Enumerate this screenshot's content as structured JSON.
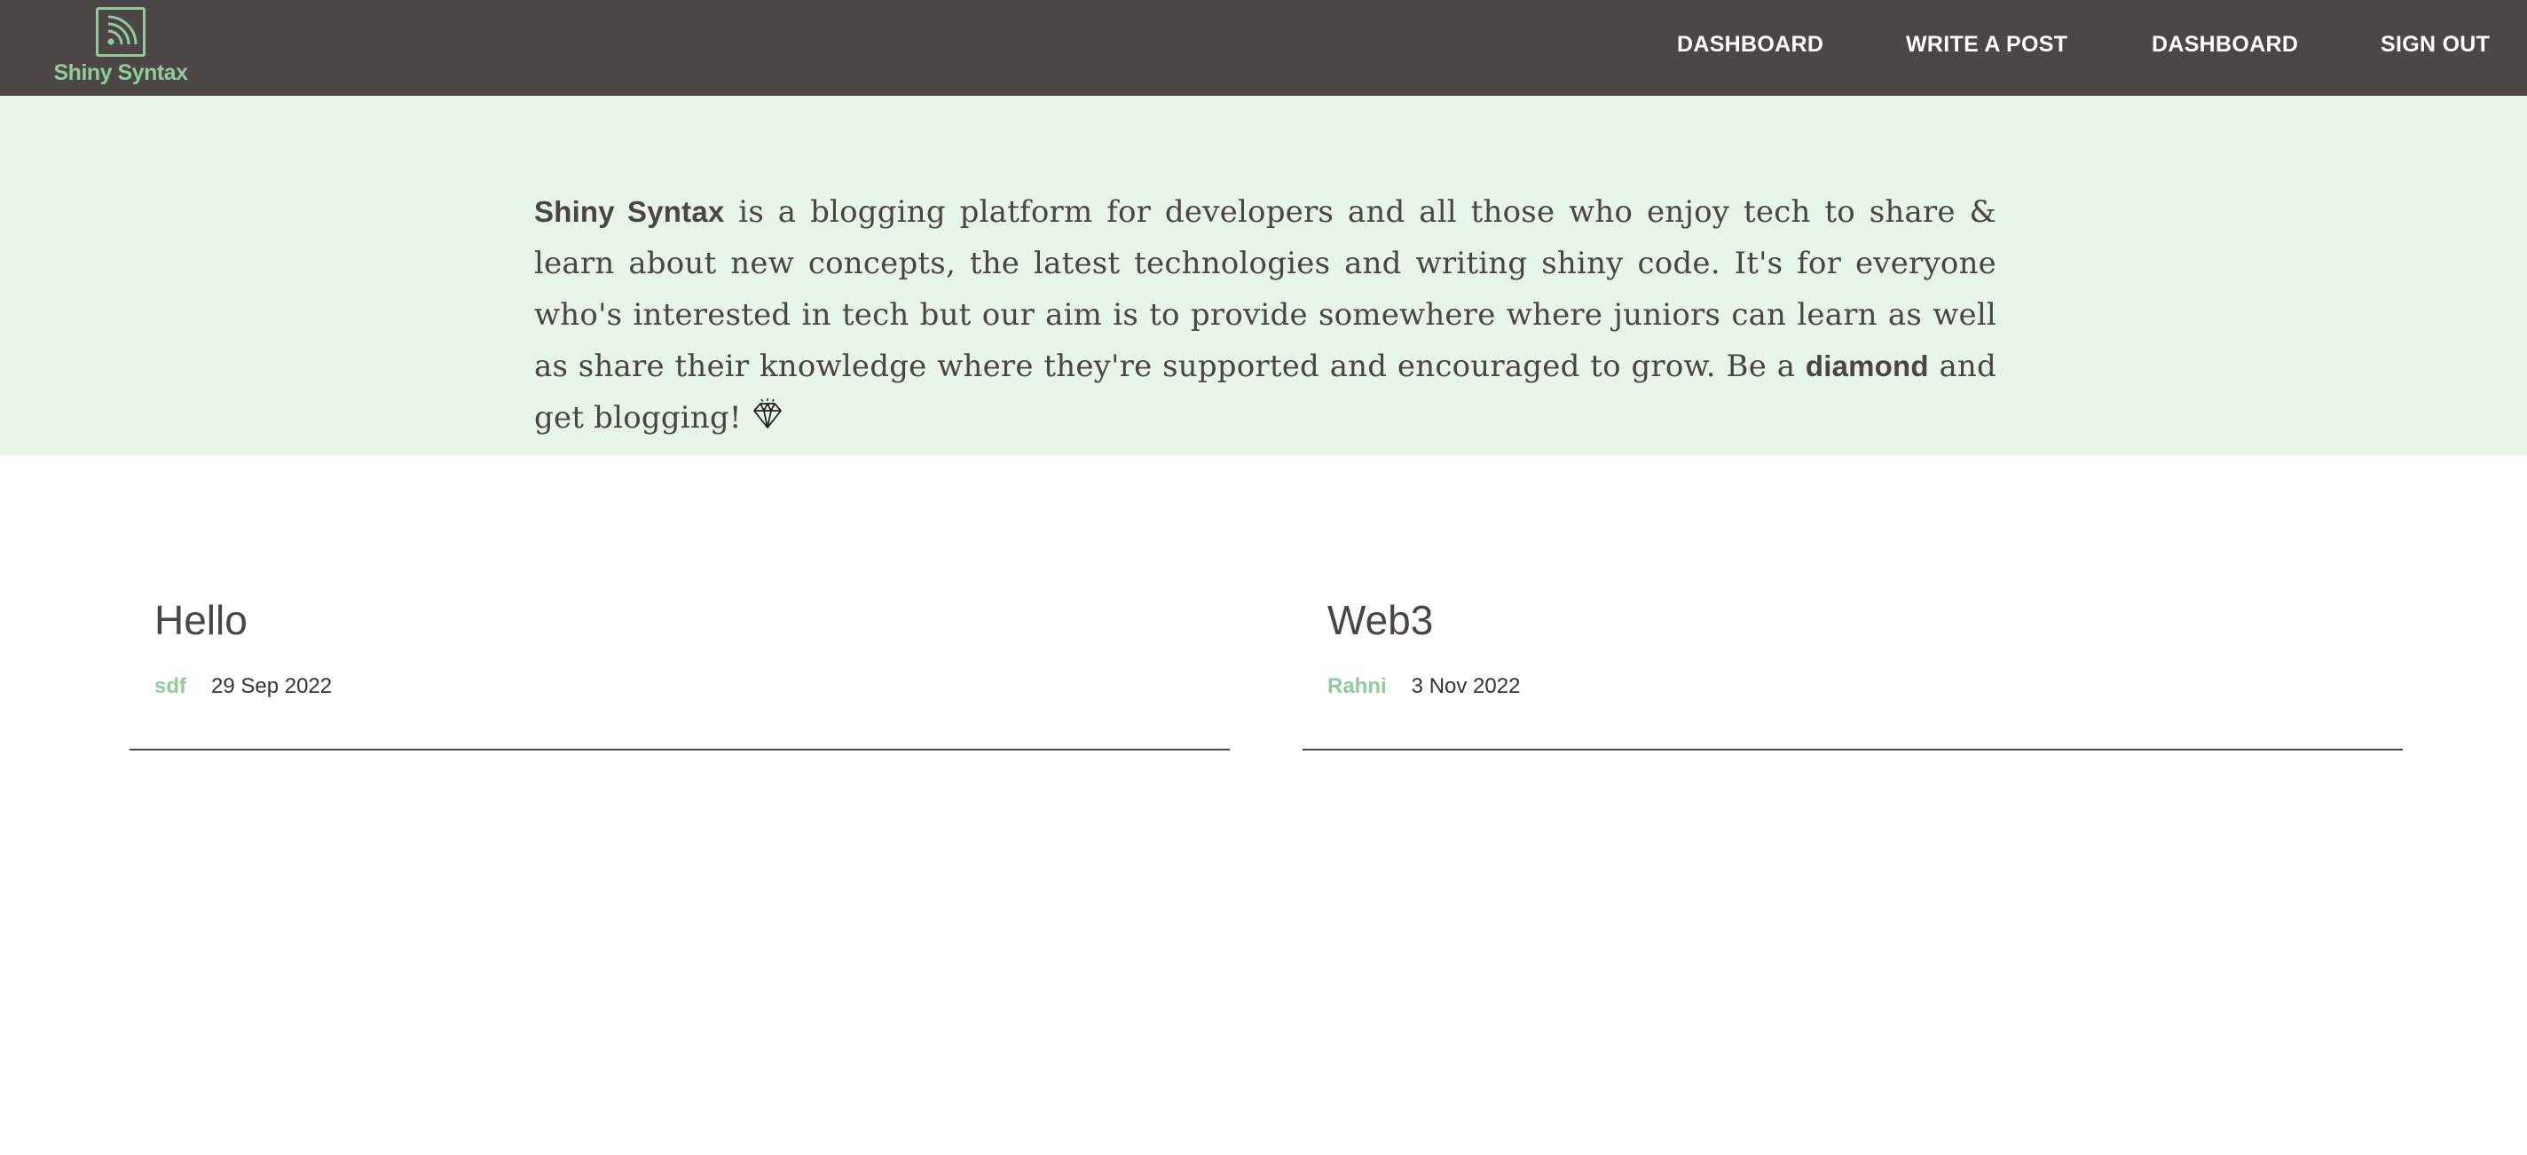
{
  "nav": {
    "logo_text": "Shiny Syntax",
    "items": [
      "DASHBOARD",
      "WRITE A POST",
      "DASHBOARD",
      "SIGN OUT"
    ]
  },
  "hero": {
    "brand": "Shiny Syntax",
    "text_1": " is a blogging platform for developers and all those who enjoy tech to share & learn about new concepts, the latest technologies and writing shiny code. It's for everyone who's interested in tech but our aim is to provide somewhere where juniors can learn as well as share their knowledge where they're supported and encouraged to grow. Be a ",
    "bold_word": "diamond",
    "text_2": " and get blogging!"
  },
  "posts": [
    {
      "title": "Hello",
      "author": "sdf",
      "date": "29 Sep 2022"
    },
    {
      "title": "Web3",
      "author": "Rahni",
      "date": "3 Nov 2022"
    }
  ],
  "colors": {
    "nav_bg": "#4c4646",
    "accent": "#8fcc98",
    "hero_bg": "#e7f4e8",
    "text": "#4a4444"
  },
  "icons": {
    "logo": "rss-feed-icon",
    "gem": "diamond-icon"
  }
}
